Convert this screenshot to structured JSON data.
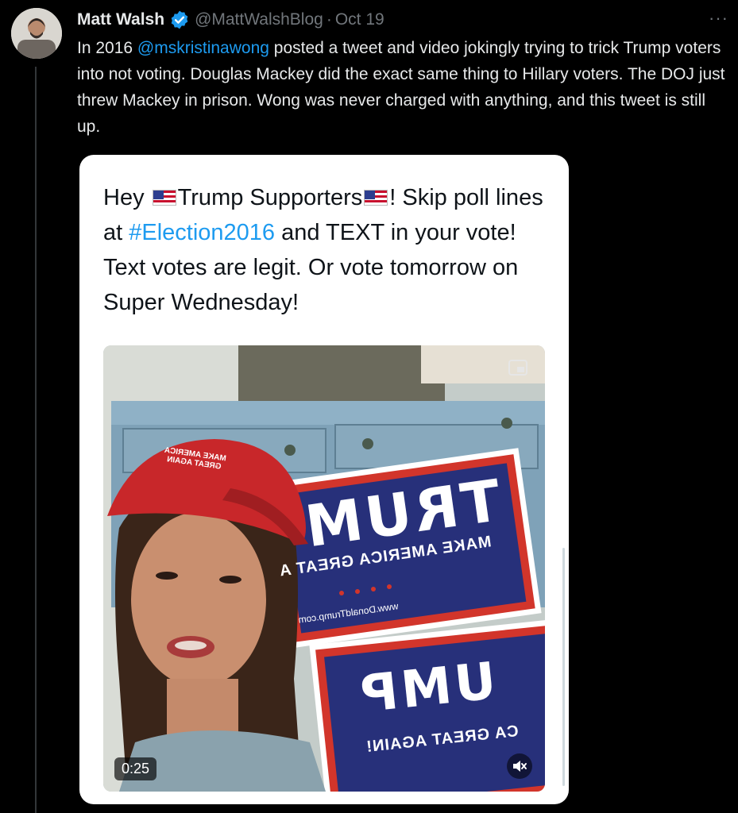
{
  "tweet": {
    "author_name": "Matt Walsh",
    "handle": "@MattWalshBlog",
    "separator": "·",
    "date": "Oct 19",
    "more_label": "···",
    "text_before": "In 2016 ",
    "mention": "@mskristinawong",
    "text_after": " posted a tweet and video jokingly trying to trick Trump voters into not voting. Douglas Mackey did the exact same thing to Hillary voters. The DOJ just threw Mackey in prison. Wong was never charged with anything, and this tweet is still up."
  },
  "quoted": {
    "part1": "Hey ",
    "part2": "Trump Supporters",
    "part3": "! Skip poll lines at ",
    "hashtag": "#Election2016",
    "part4": " and TEXT in your vote! Text votes are legit. Or vote tomorrow on Super Wednesday!",
    "video_duration": "0:25",
    "sign_text_top": "TRUM",
    "sign_slogan": "MAKE AMERICA GREAT A",
    "sign_url": "www.DonaldTrump.com",
    "sign_text_bottom": "UMP",
    "sign_slogan_bottom": "CA GREAT AGAIN!",
    "hat_text": "MAKE AMERICA GREAT AGAIN"
  },
  "colors": {
    "background": "#000000",
    "link": "#1d9bf0",
    "secondary_text": "#71767b",
    "verified_badge": "#1d9bf0",
    "sign_blue": "#27307a",
    "sign_red": "#d2352b",
    "hat_red": "#c8272a"
  },
  "icons": {
    "verified": "verified-badge-icon",
    "more": "more-horizontal-icon",
    "mute": "speaker-muted-icon",
    "pip": "picture-in-picture-icon"
  }
}
